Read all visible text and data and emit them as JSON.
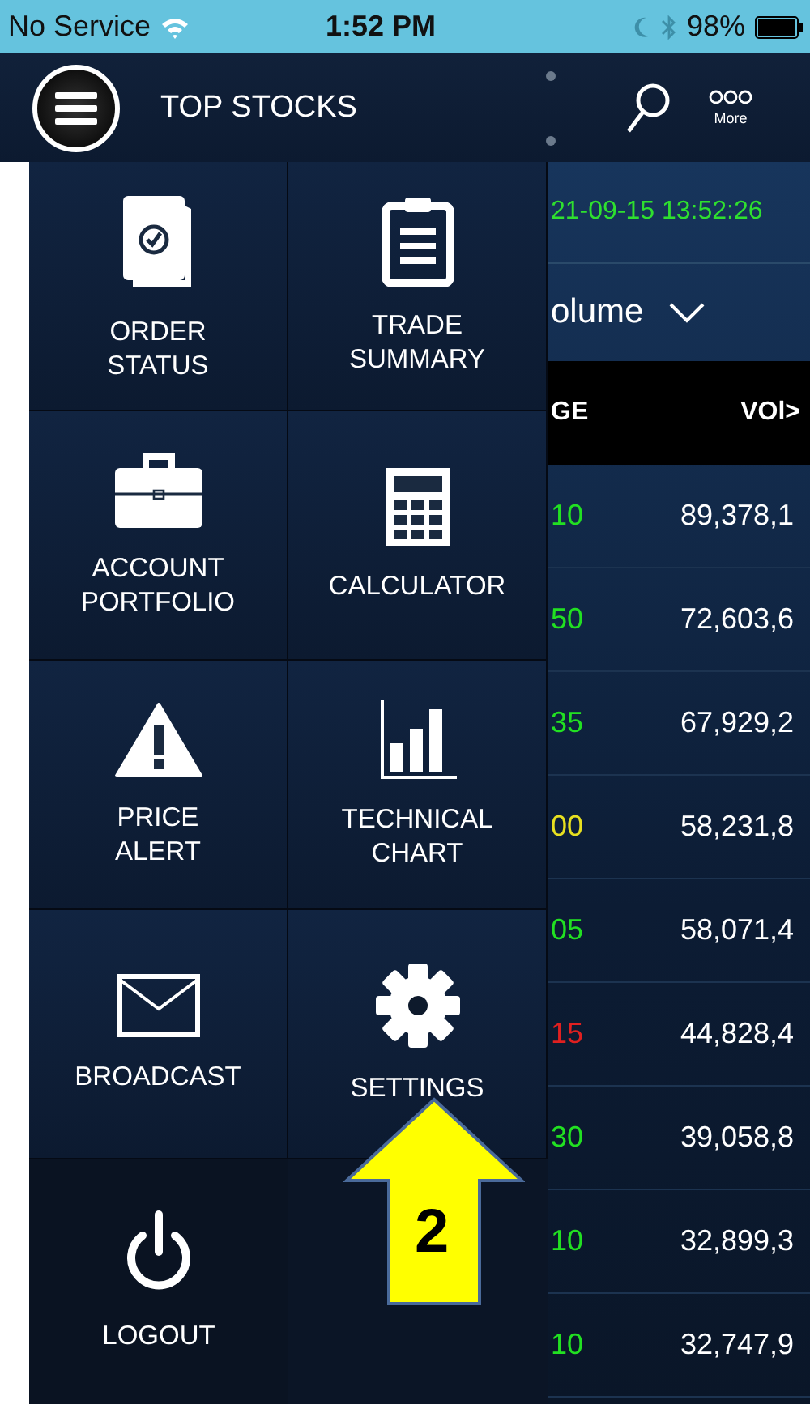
{
  "status_bar": {
    "carrier": "No Service",
    "time": "1:52 PM",
    "battery": "98%"
  },
  "header": {
    "title": "TOP STOCKS",
    "more_label": "More"
  },
  "menu": [
    {
      "lines": [
        "ORDER",
        "STATUS"
      ]
    },
    {
      "lines": [
        "TRADE",
        "SUMMARY"
      ]
    },
    {
      "lines": [
        "ACCOUNT",
        "PORTFOLIO"
      ]
    },
    {
      "lines": [
        "CALCULATOR"
      ]
    },
    {
      "lines": [
        "PRICE",
        "ALERT"
      ]
    },
    {
      "lines": [
        "TECHNICAL",
        "CHART"
      ]
    },
    {
      "lines": [
        "BROADCAST"
      ]
    },
    {
      "lines": [
        "SETTINGS"
      ]
    },
    {
      "lines": [
        "LOGOUT"
      ],
      "kind": "plain"
    }
  ],
  "market": {
    "timestamp": "21-09-15 13:52:26",
    "list_selector": "olume"
  },
  "table": {
    "columns": [
      "GE",
      "VOl>"
    ],
    "rows": [
      {
        "change": "10",
        "volume": "89,378,1",
        "color": "#22e022"
      },
      {
        "change": "50",
        "volume": "72,603,6",
        "color": "#22e022"
      },
      {
        "change": "35",
        "volume": "67,929,2",
        "color": "#22e022"
      },
      {
        "change": "00",
        "volume": "58,231,8",
        "color": "#e8e020"
      },
      {
        "change": "05",
        "volume": "58,071,4",
        "color": "#22e022"
      },
      {
        "change": "15",
        "volume": "44,828,4",
        "color": "#e02020"
      },
      {
        "change": "30",
        "volume": "39,058,8",
        "color": "#22e022"
      },
      {
        "change": "10",
        "volume": "32,899,3",
        "color": "#22e022"
      },
      {
        "change": "10",
        "volume": "32,747,9",
        "color": "#22e022"
      }
    ]
  },
  "annotation": {
    "label": "2"
  }
}
